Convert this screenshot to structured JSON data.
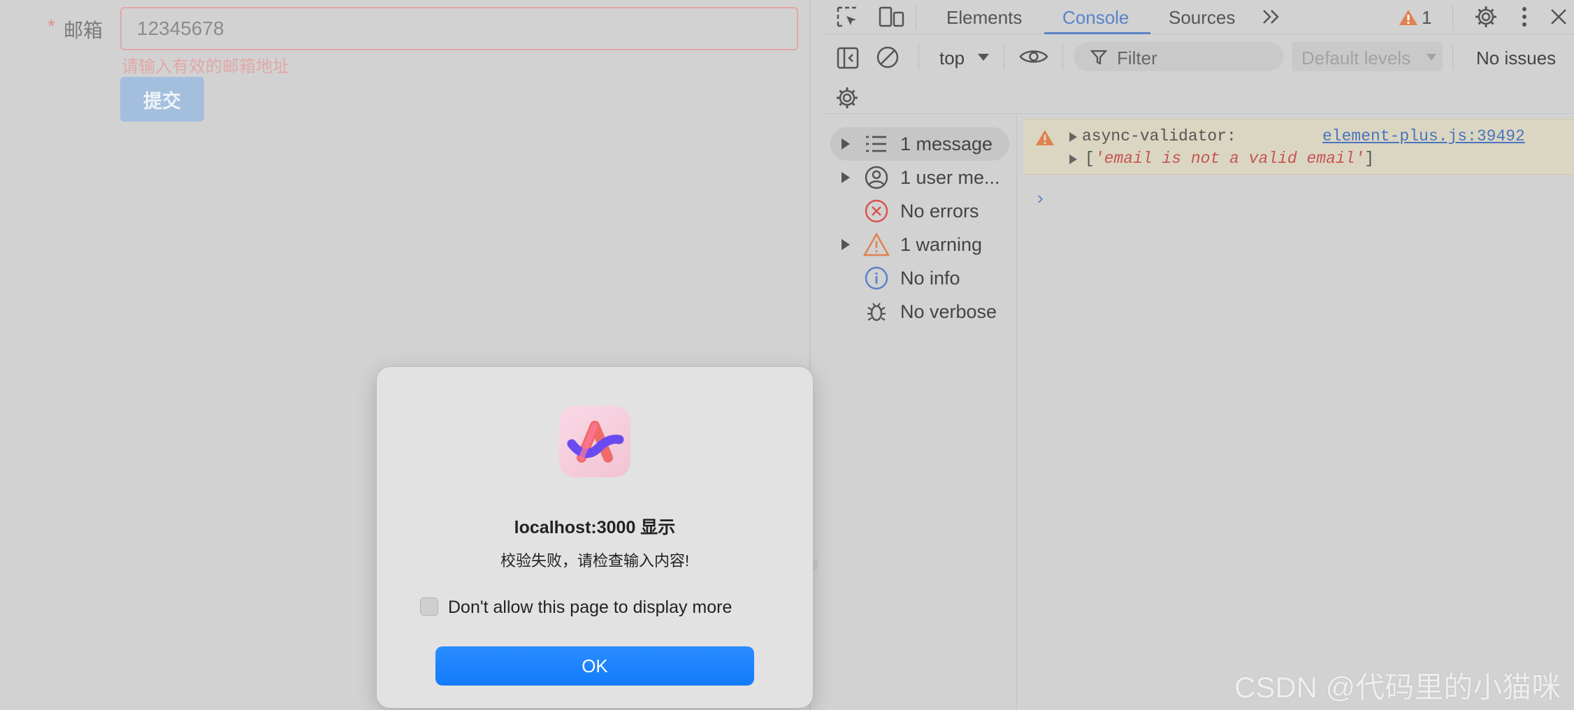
{
  "form": {
    "required_mark": "*",
    "label": "邮箱",
    "email_value": "12345678",
    "error_message": "请输入有效的邮箱地址",
    "submit_label": "提交"
  },
  "devtools": {
    "tabs": [
      {
        "label": "Elements",
        "active": false
      },
      {
        "label": "Console",
        "active": true
      },
      {
        "label": "Sources",
        "active": false
      }
    ],
    "issue_count": "1",
    "context": "top",
    "filter_placeholder": "Filter",
    "levels": "Default levels",
    "issues_status": "No issues",
    "sidebar": [
      {
        "label": "1 message",
        "icon": "list-icon",
        "expandable": true,
        "selected": true
      },
      {
        "label": "1 user me...",
        "icon": "user-icon",
        "expandable": true,
        "selected": false
      },
      {
        "label": "No errors",
        "icon": "error-icon",
        "expandable": false,
        "selected": false
      },
      {
        "label": "1 warning",
        "icon": "warning-icon",
        "expandable": true,
        "selected": false
      },
      {
        "label": "No info",
        "icon": "info-icon",
        "expandable": false,
        "selected": false
      },
      {
        "label": "No verbose",
        "icon": "bug-icon",
        "expandable": false,
        "selected": false
      }
    ],
    "console": {
      "warning_source": "async-validator:",
      "warning_link": "element-plus.js:39492",
      "warning_detail_open": "[",
      "warning_detail_value": "'email is not a valid email'",
      "warning_detail_close": "]",
      "prompt": "›"
    },
    "colors": {
      "accent": "#5b83c9",
      "warning": "#e0814f",
      "error": "#d9534f"
    }
  },
  "dialog": {
    "title": "localhost:3000 显示",
    "message": "校验失败，请检查输入内容!",
    "checkbox_label": "Don't allow this page to display more",
    "ok_label": "OK"
  },
  "watermark": "CSDN @代码里的小猫咪"
}
